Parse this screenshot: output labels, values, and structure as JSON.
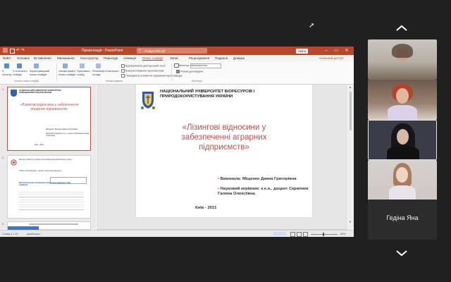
{
  "app": {
    "title": "Презентація - PowerPoint",
    "search_placeholder": "Пошук (Alt+Q)",
    "signin_label": "Увійти",
    "share_label": "Спільний доступ"
  },
  "menu": [
    "Файл",
    "Основне",
    "Вставлення",
    "Малювання",
    "Конструктор",
    "Переходи",
    "Анімація",
    "Показ слайдів",
    "Запис",
    "Рецензування",
    "Подання",
    "Довідка"
  ],
  "menu_active_index": 7,
  "ribbon": {
    "buttons": [
      "З початку",
      "З поточного слайда",
      "Користувацький показ слайдів",
      "Налаштувати показ слайдів",
      "Приховати слайд",
      "Репетиція й записати оглядк"
    ],
    "checkboxes": [
      "Відтворювати дикторський текст",
      "Використовувати хронометраж",
      "Показувати елементи керування мультимедіа"
    ],
    "monitor_label": "Монітор:",
    "monitor_value": "Автоматично",
    "presenter_view_label": "Режим доповідача",
    "groups": [
      "Почати показ слайдів",
      "Налаштування",
      "Монітори"
    ]
  },
  "slide": {
    "university": "НАЦІОНАЛЬНИЙ УНІВЕРСИТЕТ БІОРЕСУРСІВ І ПРИРОДОКОРИСТУВАННЯ УКРАЇНИ",
    "title": "«Лізингові відносини у забезпеченні аграрних підприємств»",
    "author": "Виконала: Міщенко Даяна Григорівна",
    "advisor": "Науковий керівник: к.е.н., доцент Скрипник Галина Олексіївна",
    "city_year": "Київ - 2021"
  },
  "thumb2": {
    "text1": "Метою роботи є розкриття теоретико-методичних основ...",
    "text2": "Об'єкт дослідження - процес лізингових відносин...",
    "text3": "Для досягнення поставленої мети було вирішено такі завдання:"
  },
  "notes_placeholder": "Нотатки до слайда",
  "status": {
    "slide_count": "Слайд 1 з 15",
    "language": "українська",
    "zoom": "65%"
  },
  "participants": {
    "name_label": "Гедіна Яна"
  }
}
